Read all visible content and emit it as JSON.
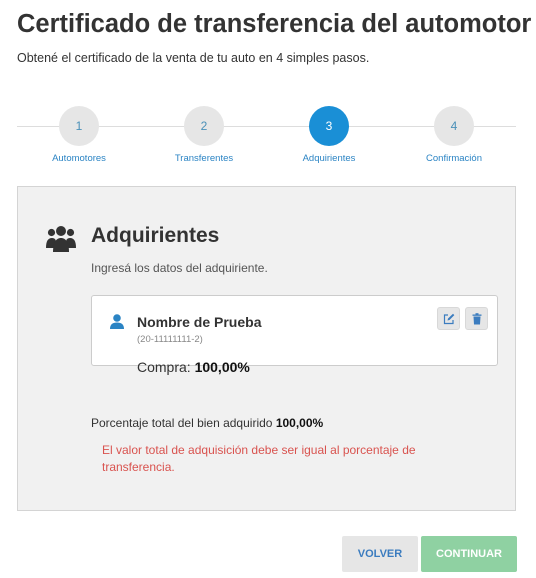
{
  "header": {
    "title": "Certificado de transferencia del automotor",
    "subtitle": "Obtené el certificado de la venta de tu auto en 4 simples pasos."
  },
  "stepper": {
    "steps": [
      {
        "number": "1",
        "label": "Automotores"
      },
      {
        "number": "2",
        "label": "Transferentes"
      },
      {
        "number": "3",
        "label": "Adquirientes"
      },
      {
        "number": "4",
        "label": "Confirmación"
      }
    ],
    "active_step": 3
  },
  "section": {
    "icon": "users-icon",
    "title": "Adquirientes",
    "description": "Ingresá los datos del adquiriente."
  },
  "acquirer": {
    "icon": "user-icon",
    "name": "Nombre de Prueba",
    "id": "(20-11111111-2)",
    "purchase_label": "Compra:",
    "purchase_value": "100,00%",
    "actions": {
      "edit_icon": "edit-icon",
      "delete_icon": "trash-icon"
    }
  },
  "summary": {
    "total_label": "Porcentaje total del bien adquirido",
    "total_value": "100,00%",
    "error": "El valor total de adquisición debe ser igual al porcentaje de transferencia."
  },
  "footer": {
    "back_label": "VOLVER",
    "continue_label": "CONTINUAR"
  },
  "colors": {
    "accent": "#1a8fd6",
    "link": "#2b84c4",
    "error": "#d9534f",
    "continue_disabled": "#8fd1a2"
  }
}
